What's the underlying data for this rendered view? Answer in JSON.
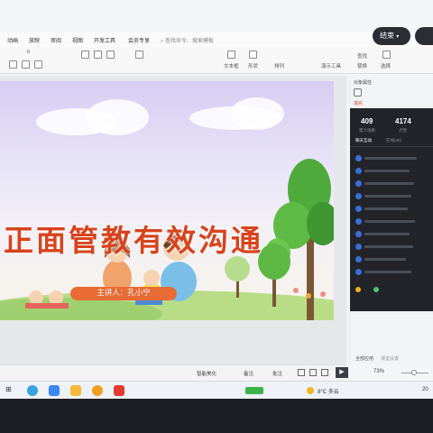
{
  "menu": {
    "items": [
      "动画",
      "放映",
      "审阅",
      "视图",
      "开发工具",
      "会员专享"
    ],
    "search_placeholder": "查找命令、搜索模板"
  },
  "ribbon": {
    "font_size": "0",
    "labels": [
      "文本框",
      "形状",
      "排列",
      "演示工具",
      "查找",
      "替换",
      "选择"
    ]
  },
  "slide": {
    "title": "正面管教有效沟通",
    "speaker": "主讲人：孔小宁"
  },
  "right_panel": {
    "header": "对象属性",
    "header2": "填充",
    "stats": [
      {
        "value": "409",
        "label": "累计观看"
      },
      {
        "value": "4174",
        "label": "点赞"
      }
    ],
    "tabs": [
      "聊天互动",
      "在线(40)"
    ],
    "footer_link1": "全部应用",
    "footer_link2": "课堂设置"
  },
  "float_button": {
    "label": "结束"
  },
  "status_bar": {
    "items": [
      "智能美化",
      "备注",
      "批注"
    ],
    "zoom": "73%"
  },
  "taskbar": {
    "weather": "8°C 多云",
    "time": "20"
  },
  "colors": {
    "accent": "#e86a34",
    "title": "#d8431d",
    "panel_dark": "#22242a"
  }
}
